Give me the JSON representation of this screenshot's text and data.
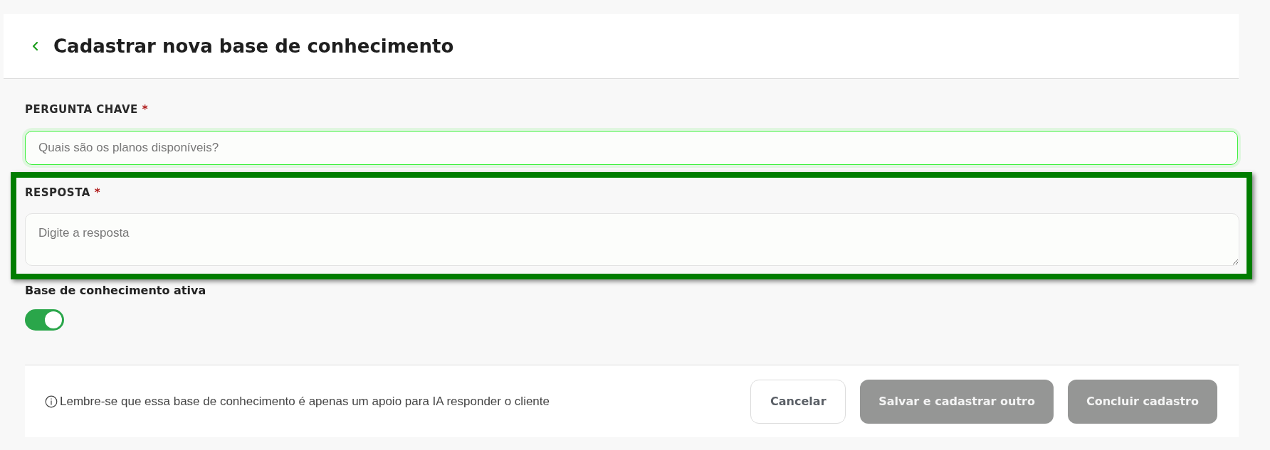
{
  "header": {
    "back_icon": true,
    "title": "Cadastrar nova base de conhecimento"
  },
  "fields": [
    {
      "kind": "input",
      "label": "PERGUNTA CHAVE",
      "required_mark": "*",
      "placeholder": "Quais são os planos disponíveis?",
      "focused": true,
      "highlighted": false
    },
    {
      "kind": "textarea",
      "label": "RESPOSTA",
      "required_mark": "*",
      "placeholder": "Digite a resposta",
      "focused": false,
      "highlighted": true
    }
  ],
  "toggle": {
    "label": "Base de conhecimento ativa",
    "on": true
  },
  "footer": {
    "note": "Lembre-se que essa base de conhecimento é apenas um apoio para IA responder o cliente",
    "buttons": [
      {
        "kind": "outline",
        "label": "Cancelar",
        "disabled": false
      },
      {
        "kind": "filled",
        "label": "Salvar e cadastrar outro",
        "disabled": true
      },
      {
        "kind": "filled",
        "label": "Concluir cadastro",
        "disabled": true
      }
    ]
  }
}
